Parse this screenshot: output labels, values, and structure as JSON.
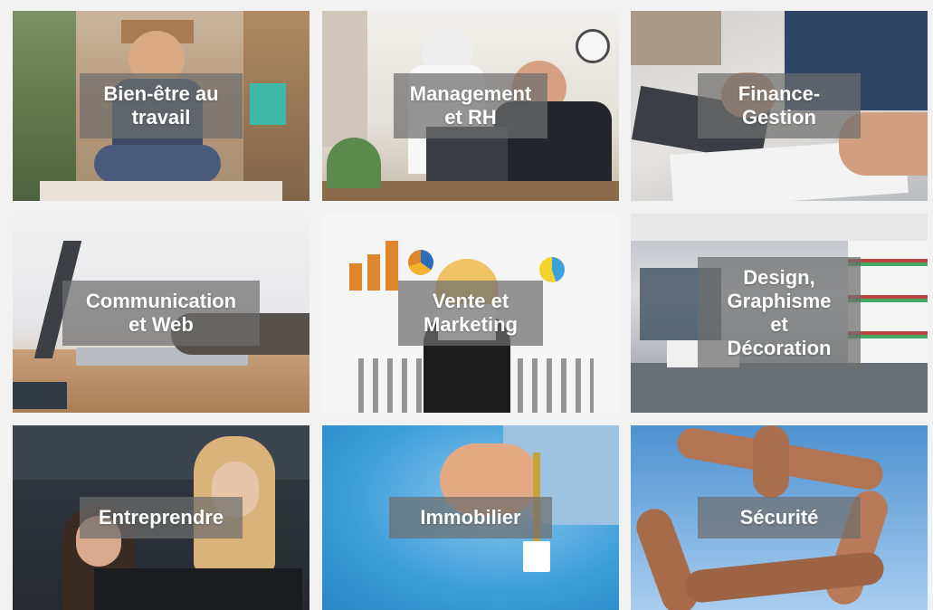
{
  "tiles": [
    {
      "id": "t1",
      "label": "Bien-être au\ntravail",
      "theme": "office-meditation",
      "colors": [
        "#b89a7a",
        "#7f6a58",
        "#3b4c6b"
      ]
    },
    {
      "id": "t2",
      "label": "Management\net RH",
      "theme": "office-meeting",
      "colors": [
        "#e7e4e0",
        "#c0b6a8",
        "#2a2c32"
      ]
    },
    {
      "id": "t3",
      "label": "Finance-\nGestion",
      "theme": "calculator-documents",
      "colors": [
        "#d8d6d3",
        "#8b8f96",
        "#2c3e5a"
      ]
    },
    {
      "id": "t4",
      "label": "Communication\net Web",
      "theme": "laptop-desk",
      "colors": [
        "#efeff0",
        "#c9a98a",
        "#4b4b4b"
      ]
    },
    {
      "id": "t5",
      "label": "Vente et\nMarketing",
      "theme": "marketing-drawings",
      "colors": [
        "#f4f4f4",
        "#e0862a",
        "#3da0d9"
      ]
    },
    {
      "id": "t6",
      "label": "Design,\nGraphisme\net\nDécoration",
      "theme": "modern-office",
      "colors": [
        "#d9dbde",
        "#7f8791",
        "#40454d"
      ]
    },
    {
      "id": "t7",
      "label": "Entreprendre",
      "theme": "people-computer-dark",
      "colors": [
        "#2a2e34",
        "#4a5059",
        "#c79a6a"
      ]
    },
    {
      "id": "t8",
      "label": "Immobilier",
      "theme": "hand-key",
      "colors": [
        "#3b9dd8",
        "#7ec0e8",
        "#f0f4f8"
      ]
    },
    {
      "id": "t9",
      "label": "Sécurité",
      "theme": "linked-hands",
      "colors": [
        "#5a9bd5",
        "#8cbbe6",
        "#a86b4a"
      ]
    }
  ]
}
